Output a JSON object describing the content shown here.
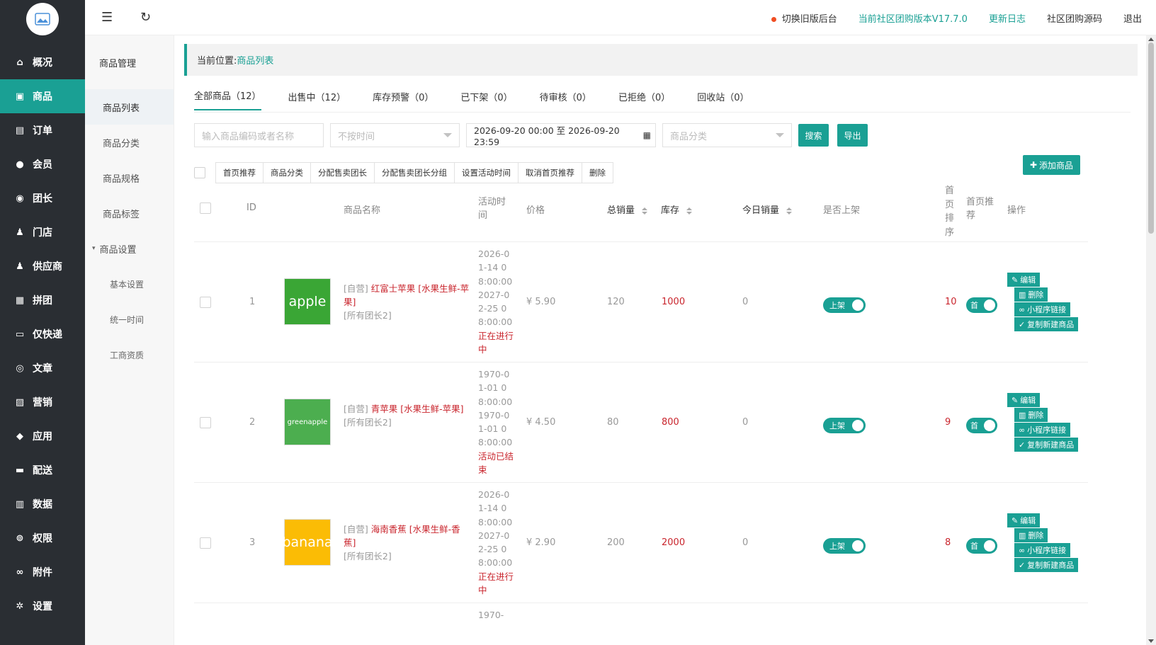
{
  "sidebar": {
    "items": [
      {
        "label": "概况",
        "icon": "home-icon",
        "glyph": "⌂"
      },
      {
        "label": "商品",
        "icon": "goods-icon",
        "glyph": "▣",
        "active": true
      },
      {
        "label": "订单",
        "icon": "order-icon",
        "glyph": "▤"
      },
      {
        "label": "会员",
        "icon": "users-icon",
        "glyph": "●"
      },
      {
        "label": "团长",
        "icon": "leader-icon",
        "glyph": "◉"
      },
      {
        "label": "门店",
        "icon": "store-icon",
        "glyph": "♟"
      },
      {
        "label": "供应商",
        "icon": "supplier-icon",
        "glyph": "♟"
      },
      {
        "label": "拼团",
        "icon": "group-buy-icon",
        "glyph": "▦"
      },
      {
        "label": "仅快递",
        "icon": "express-icon",
        "glyph": "▭"
      },
      {
        "label": "文章",
        "icon": "compass-icon",
        "glyph": "◎"
      },
      {
        "label": "营销",
        "icon": "gift-icon",
        "glyph": "▨"
      },
      {
        "label": "应用",
        "icon": "cube-icon",
        "glyph": "◆"
      },
      {
        "label": "配送",
        "icon": "truck-icon",
        "glyph": "▬"
      },
      {
        "label": "数据",
        "icon": "chart-icon",
        "glyph": "▥"
      },
      {
        "label": "权限",
        "icon": "lock-icon",
        "glyph": "⊚"
      },
      {
        "label": "附件",
        "icon": "link-icon",
        "glyph": "∞"
      },
      {
        "label": "设置",
        "icon": "gear-icon",
        "glyph": "✲"
      }
    ]
  },
  "subnav": {
    "title": "商品管理",
    "items": [
      "商品列表",
      "商品分类",
      "商品规格",
      "商品标签"
    ],
    "group": "商品设置",
    "children": [
      "基本设置",
      "统一时间",
      "工商资质"
    ]
  },
  "topbar": {
    "switch_old": "切换旧版后台",
    "version": "当前社区团购版本V17.7.0",
    "changelog": "更新日志",
    "source": "社区团购源码",
    "logout": "退出"
  },
  "breadcrumb": {
    "prefix": "当前位置:",
    "current": "商品列表"
  },
  "tabs": [
    "全部商品（12）",
    "出售中（12）",
    "库存预警（0）",
    "已下架（0）",
    "待审核（0）",
    "已拒绝（0）",
    "回收站（0）"
  ],
  "filters": {
    "keyword_placeholder": "输入商品编码或者名称",
    "time_placeholder": "不按时间",
    "date_range": "2026-09-20 00:00 至 2026-09-20 23:59",
    "category_placeholder": "商品分类",
    "search": "搜索",
    "export": "导出"
  },
  "batch_actions": [
    "首页推荐",
    "商品分类",
    "分配售卖团长",
    "分配售卖团长分组",
    "设置活动时间",
    "取消首页推荐",
    "删除"
  ],
  "add_button": "添加商品",
  "columns": {
    "id": "ID",
    "name": "商品名称",
    "time": "活动时间",
    "price": "价格",
    "total_sales": "总销量",
    "stock": "库存",
    "today_sales": "今日销量",
    "on_sale": "是否上架",
    "sort": "首页排序",
    "recommend": "首页推荐",
    "ops": "操作"
  },
  "ops": [
    "编辑",
    "删除",
    "小程序链接",
    "复制新建商品"
  ],
  "toggle_on": "上架",
  "toggle_rec": "首",
  "rows": [
    {
      "id": "1",
      "thumb_text": "apple",
      "thumb_color": "#3aa635",
      "tag": "[自营]",
      "name": "红富士苹果 [水果生鲜-苹果]",
      "owner": "[所有团长2]",
      "time": "2026-01-14 08:00:00 2027-02-25 08:00:00",
      "status": "正在进行中",
      "price": "¥ 5.90",
      "total": "120",
      "stock": "1000",
      "today": "0",
      "sort": "10"
    },
    {
      "id": "2",
      "thumb_text": "greenapple",
      "thumb_color": "#4cae4f",
      "tag": "[自营]",
      "name": "青苹果 [水果生鲜-苹果]",
      "owner": "[所有团长2]",
      "time": "1970-01-01 08:00:00 1970-01-01 08:00:00",
      "status": "活动已结束",
      "price": "¥ 4.50",
      "total": "80",
      "stock": "800",
      "today": "0",
      "sort": "9"
    },
    {
      "id": "3",
      "thumb_text": "banana",
      "thumb_color": "#fbbc05",
      "tag": "[自营]",
      "name": "海南香蕉 [水果生鲜-香蕉]",
      "owner": "[所有团长2]",
      "time": "2026-01-14 08:00:00 2027-02-25 08:00:00",
      "status": "正在进行中",
      "price": "¥ 2.90",
      "total": "200",
      "stock": "2000",
      "today": "0",
      "sort": "8"
    }
  ],
  "next_row_time": "1970-"
}
